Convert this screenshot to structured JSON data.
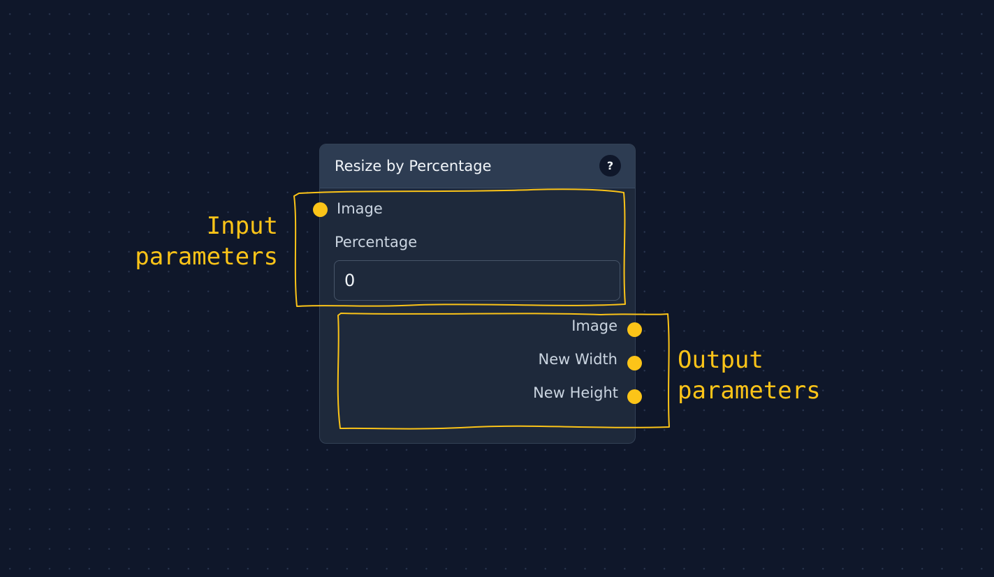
{
  "node": {
    "title": "Resize by Percentage",
    "help_label": "?",
    "inputs": {
      "image_label": "Image",
      "percentage_label": "Percentage",
      "percentage_value": "0"
    },
    "outputs": [
      {
        "label": "Image"
      },
      {
        "label": "New Width"
      },
      {
        "label": "New Height"
      }
    ]
  },
  "annotations": {
    "input_line1": "Input",
    "input_line2": "parameters",
    "output_line1": "Output",
    "output_line2": "parameters"
  },
  "colors": {
    "background": "#0f172a",
    "node_body": "#1e293b",
    "node_header": "#2d3c52",
    "handle": "#fcc418",
    "annotation": "#fcc418"
  }
}
